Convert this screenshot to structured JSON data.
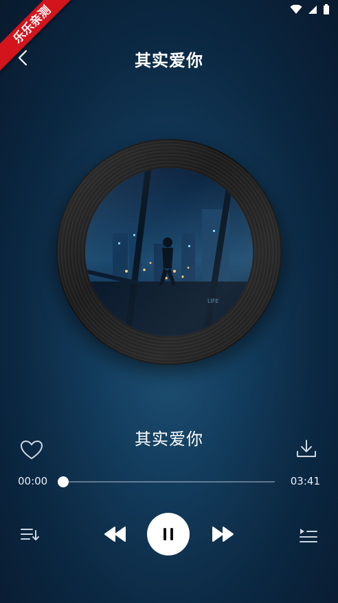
{
  "ribbon": {
    "text": "乐乐亲测"
  },
  "header": {
    "title": "其实爱你"
  },
  "song": {
    "title": "其实爱你"
  },
  "player": {
    "current_time": "00:00",
    "total_time": "03:41",
    "progress": 0.0
  },
  "icons": {
    "back": "chevron-left-icon",
    "like": "heart-outline-icon",
    "download": "download-icon",
    "playlist": "playlist-icon",
    "prev": "rewind-icon",
    "play_pause": "pause-icon",
    "next": "fast-forward-icon",
    "queue": "queue-list-icon"
  },
  "colors": {
    "background": "#0b2741",
    "accent": "#ffffff",
    "ribbon": "#d3141c"
  }
}
